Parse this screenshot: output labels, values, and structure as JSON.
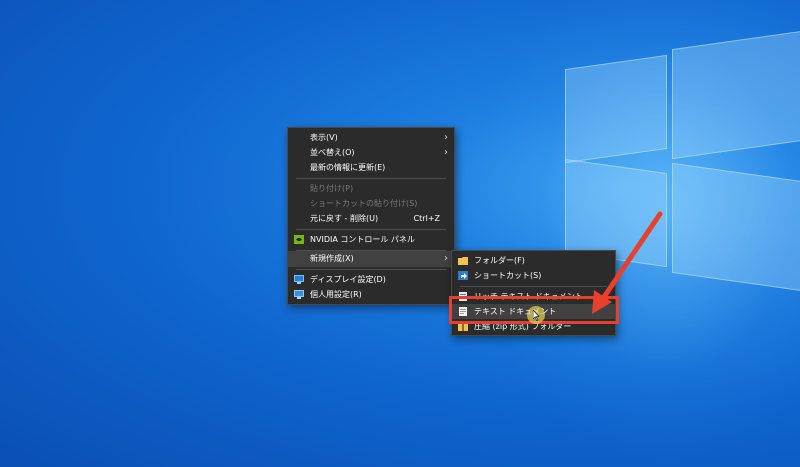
{
  "context_menu": {
    "items": [
      {
        "label": "表示(V)",
        "submenu": true
      },
      {
        "label": "並べ替え(O)",
        "submenu": true
      },
      {
        "label": "最新の情報に更新(E)"
      },
      {
        "label": "貼り付け(P)",
        "disabled": true
      },
      {
        "label": "ショートカットの貼り付け(S)",
        "disabled": true
      },
      {
        "label": "元に戻す - 削除(U)",
        "shortcut": "Ctrl+Z"
      },
      {
        "label": "NVIDIA コントロール パネル",
        "icon": "nvidia-icon"
      },
      {
        "label": "新規作成(X)",
        "submenu": true,
        "highlighted": true
      },
      {
        "label": "ディスプレイ設定(D)",
        "icon": "display-icon"
      },
      {
        "label": "個人用設定(R)",
        "icon": "personalize-icon"
      }
    ]
  },
  "new_submenu": {
    "items": [
      {
        "label": "フォルダー(F)",
        "icon": "folder-icon"
      },
      {
        "label": "ショートカット(S)",
        "icon": "shortcut-icon"
      },
      {
        "label": "リッチ テキスト ドキュメント",
        "icon": "richtext-icon"
      },
      {
        "label": "テキスト ドキュメント",
        "icon": "text-document-icon",
        "highlighted": true
      },
      {
        "label": "圧縮 (zip 形式) フォルダー",
        "icon": "zip-folder-icon"
      }
    ]
  },
  "annotation": {
    "arrow_color": "#e8412b",
    "box_color": "#e8412b"
  },
  "colors": {
    "menu_bg": "#2b2b2b",
    "menu_hover": "#414141",
    "disabled_text": "#7a7a7a"
  }
}
